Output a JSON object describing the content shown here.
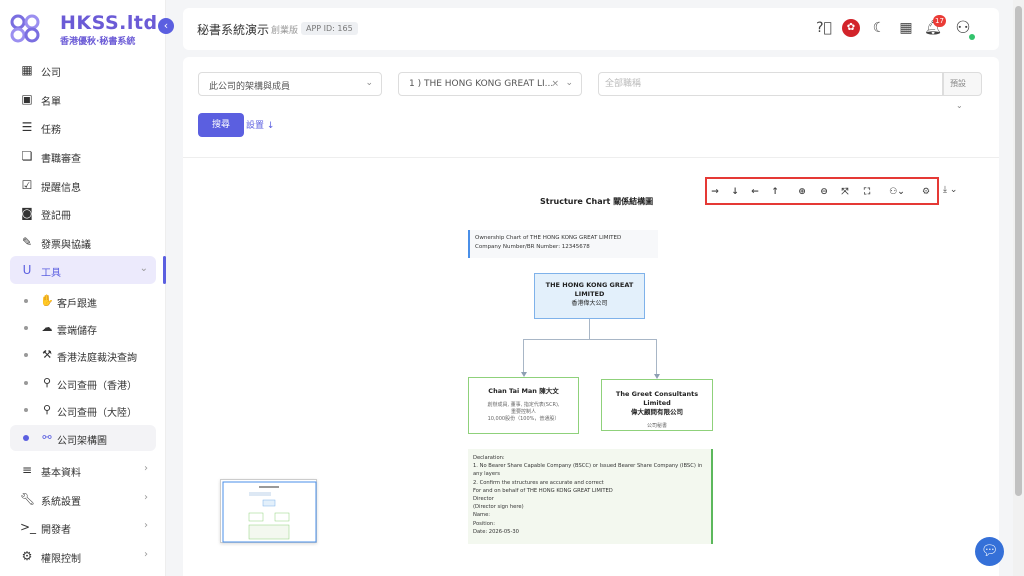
{
  "logo": {
    "title": "HKSS.ltd",
    "subtitle": "香港優秋·秘書系統"
  },
  "sidebar": {
    "items": [
      {
        "label": "公司",
        "icon": "building-icon"
      },
      {
        "label": "名單",
        "icon": "contacts-icon"
      },
      {
        "label": "任務",
        "icon": "checklist-icon"
      },
      {
        "label": "書職審查",
        "icon": "documents-icon"
      },
      {
        "label": "提醒信息",
        "icon": "calendar-check-icon"
      },
      {
        "label": "登記冊",
        "icon": "register-icon"
      },
      {
        "label": "發票與協議",
        "icon": "pen-icon"
      },
      {
        "label": "工具",
        "icon": "magnet-icon"
      }
    ],
    "tools_sub": [
      {
        "label": "客戶跟進",
        "icon": "handshake-icon"
      },
      {
        "label": "雲端儲存",
        "icon": "cloud-icon"
      },
      {
        "label": "香港法庭裁決查詢",
        "icon": "gavel-icon"
      },
      {
        "label": "公司查冊（香港）",
        "icon": "search-icon"
      },
      {
        "label": "公司查冊（大陸）",
        "icon": "search-icon"
      },
      {
        "label": "公司架構圖",
        "icon": "org-chart-icon"
      }
    ],
    "bottom_items": [
      {
        "label": "基本資料",
        "icon": "database-icon"
      },
      {
        "label": "系統設置",
        "icon": "wrench-icon"
      },
      {
        "label": "開發者",
        "icon": "terminal-icon"
      },
      {
        "label": "權限控制",
        "icon": "gears-icon"
      }
    ]
  },
  "header": {
    "title": "秘書系統演示",
    "edition": "創業版",
    "app_id": "APP ID: 165",
    "notification_count": "17"
  },
  "filters": {
    "scope": "此公司的架構與成員",
    "company": "1 ) THE HONG KONG GREAT LI...",
    "role_placeholder": "全部職稱",
    "preset": "預設",
    "search_label": "搜尋",
    "settings_label": "設置"
  },
  "chart": {
    "title": "Structure Chart 關係結構圖",
    "info_line1": "Ownership Chart of THE HONG KONG GREAT LIMITED",
    "info_line2": "Company Number/BR Number: 12345678",
    "root_name_en": "THE HONG KONG GREAT LIMITED",
    "root_name_zh": "香港偉大公司",
    "person_name": "Chan Tai Man 陳大文",
    "person_role1": "創辦成員, 董事, 指定代表(SCR),",
    "person_role2": "重要控制人",
    "person_shares": "10,000股份（100%，普通股）",
    "company_name_en": "The Greet Consultants Limited",
    "company_name_zh": "偉大顧問有限公司",
    "company_role": "公司秘書",
    "declaration": [
      "Declaration:",
      "1. No Bearer Share Capable Company (BSCC) or Issued Bearer Share Company (IBSC) in any layers",
      "2. Confirm the structures are accurate and correct",
      "For and on behalf of THE HONG KONG GREAT LIMITED",
      "Director",
      "(Director sign here)",
      "Name:",
      "Position:",
      "Date: 2026-05-30"
    ]
  },
  "colors": {
    "accent": "#5b5fe0",
    "highlight": "#e53935",
    "root_node": "#e3f0fb",
    "green_border": "#5cb85c"
  }
}
